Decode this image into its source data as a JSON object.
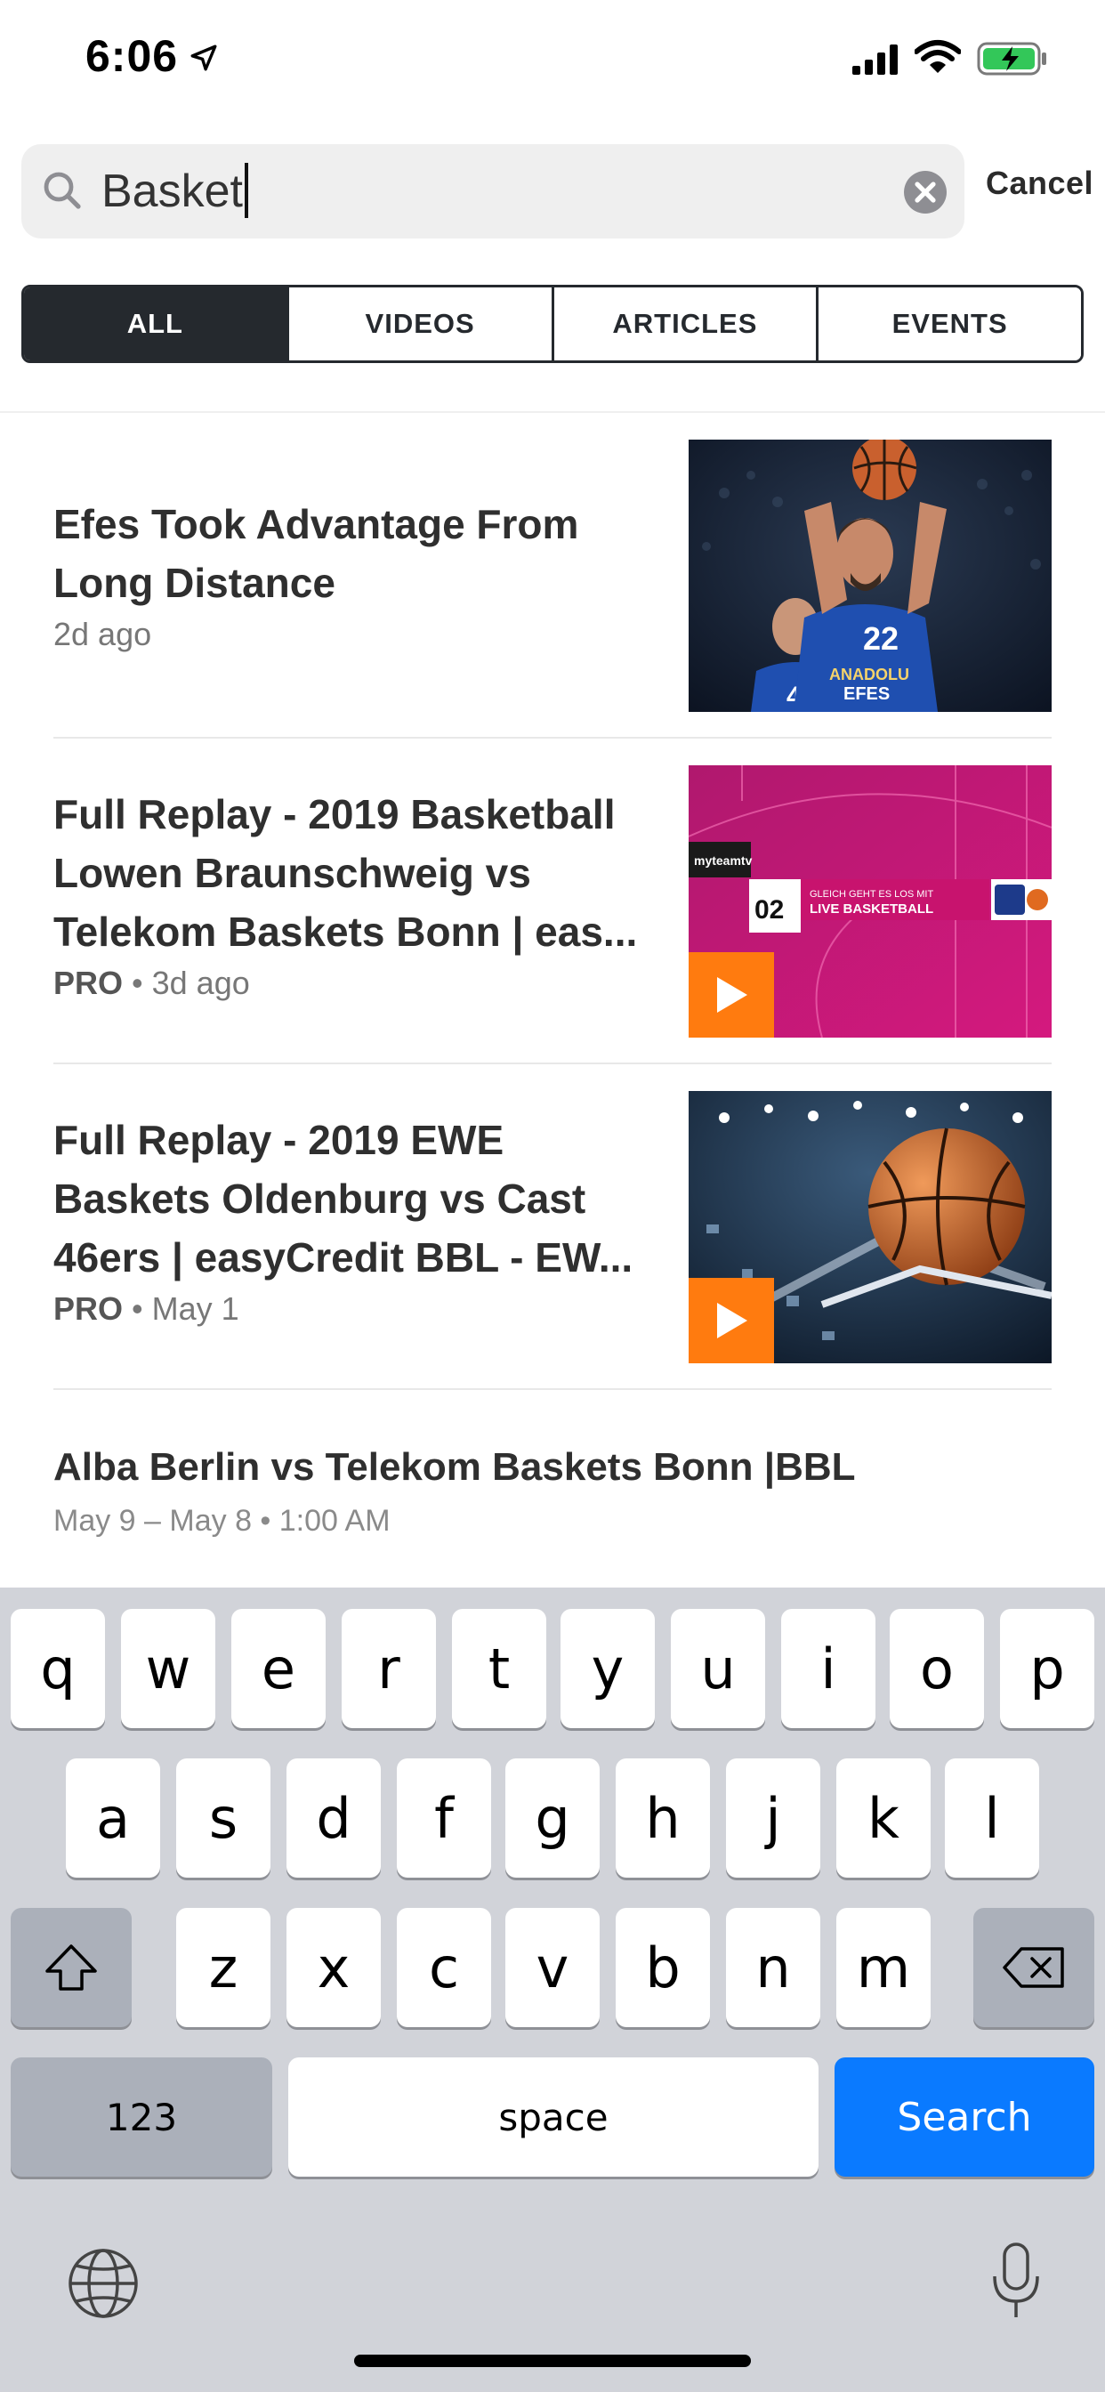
{
  "status_bar": {
    "time": "6:06"
  },
  "search": {
    "query": "Basket",
    "cancel_label": "Cancel"
  },
  "tabs": [
    {
      "label": "ALL",
      "active": true
    },
    {
      "label": "VIDEOS",
      "active": false
    },
    {
      "label": "ARTICLES",
      "active": false
    },
    {
      "label": "EVENTS",
      "active": false
    }
  ],
  "results": [
    {
      "title": "Efes Took Advantage From Long Distance",
      "pro": "",
      "meta": "2d ago",
      "thumbnail": "basketball-player-shooting",
      "has_play": false
    },
    {
      "title": "Full Replay - 2019 Basketball Lowen Braunschweig vs Telekom Baskets Bonn | eas...",
      "pro": "PRO",
      "meta": "3d ago",
      "thumbnail": "magenta-live-basketball-banner",
      "has_play": true,
      "banner_text": "GLEICH GEHT ES LOS MIT",
      "banner_sub": "LIVE BASKETBALL",
      "score_text": "02"
    },
    {
      "title": "Full Replay - 2019 EWE Baskets Oldenburg vs Cast 46ers | easyCredit BBL - EW...",
      "pro": "PRO",
      "meta": "May 1",
      "thumbnail": "basketball-in-hoop-arena",
      "has_play": true
    }
  ],
  "event": {
    "title": "Alba Berlin vs Telekom Baskets Bonn |BBL",
    "meta": "May 9 – May 8 • 1:00 AM"
  },
  "keyboard": {
    "row1": [
      "q",
      "w",
      "e",
      "r",
      "t",
      "y",
      "u",
      "i",
      "o",
      "p"
    ],
    "row2": [
      "a",
      "s",
      "d",
      "f",
      "g",
      "h",
      "j",
      "k",
      "l"
    ],
    "row3": [
      "z",
      "x",
      "c",
      "v",
      "b",
      "n",
      "m"
    ],
    "numbers_label": "123",
    "space_label": "space",
    "search_label": "Search"
  },
  "colors": {
    "accent_orange": "#ff7b0f",
    "keyboard_blue": "#0a7aff",
    "segment_dark": "#25292e"
  }
}
